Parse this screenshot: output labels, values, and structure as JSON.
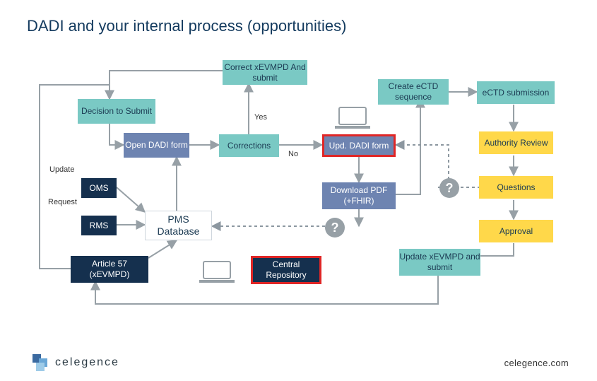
{
  "title": "DADI and your internal process (opportunities)",
  "footer": {
    "brand": "celegence",
    "url": "celegence.com"
  },
  "labels": {
    "update": "Update",
    "request": "Request",
    "yes": "Yes",
    "no": "No"
  },
  "nodes": {
    "decision": {
      "text": "Decision to Submit"
    },
    "correct_xevmpd": {
      "text": "Correct xEVMPD And submit"
    },
    "open_dadi": {
      "text": "Open DADI form"
    },
    "corrections": {
      "text": "Corrections"
    },
    "upd_dadi": {
      "text": "Upd. DADI form"
    },
    "download_pdf": {
      "text": "Download PDF (+FHIR)"
    },
    "create_ectd": {
      "text": "Create eCTD sequence"
    },
    "ectd_sub": {
      "text": "eCTD submission"
    },
    "auth_review": {
      "text": "Authority Review"
    },
    "questions": {
      "text": "Questions"
    },
    "approval": {
      "text": "Approval"
    },
    "update_xevmpd": {
      "text": "Update xEVMPD and submit"
    },
    "oms": {
      "text": "OMS"
    },
    "rms": {
      "text": "RMS"
    },
    "pms_db": {
      "text": "PMS Database"
    },
    "article57": {
      "text": "Article 57 (xEVMPD)"
    },
    "central_repo": {
      "text": "Central Repository"
    }
  },
  "icons": {
    "laptop": "laptop-icon",
    "question": "question-icon"
  }
}
